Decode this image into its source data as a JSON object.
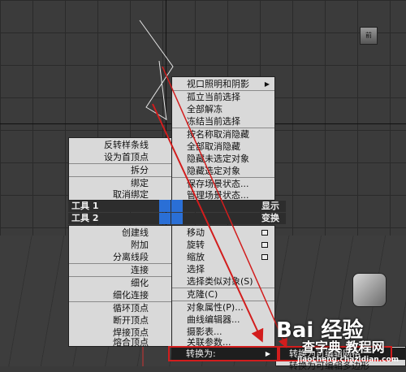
{
  "viewport": {
    "cube_label": "前"
  },
  "right_menu": {
    "items": [
      {
        "label": "视口照明和阴影",
        "submenu": true
      },
      {
        "label": "孤立当前选择"
      },
      {
        "label": "全部解冻"
      },
      {
        "label": "冻结当前选择"
      },
      {
        "label": "按名称取消隐藏"
      },
      {
        "label": "全部取消隐藏"
      },
      {
        "label": "隐藏未选定对象"
      },
      {
        "label": "隐藏选定对象"
      },
      {
        "label": "保存场景状态..."
      },
      {
        "label": "管理场景状态..."
      }
    ]
  },
  "left_menu": {
    "items": [
      {
        "label": "反转样条线"
      },
      {
        "label": "设为首顶点"
      },
      {
        "label": "拆分"
      },
      {
        "label": "绑定"
      },
      {
        "label": "取消绑定"
      }
    ]
  },
  "headers": {
    "tools1": "工具 1",
    "tools2": "工具 2",
    "display": "显示",
    "transform": "变换"
  },
  "tools_menu": {
    "items": [
      {
        "label": "创建线"
      },
      {
        "label": "附加"
      },
      {
        "label": "分离线段"
      },
      {
        "label": "连接"
      },
      {
        "label": "细化"
      },
      {
        "label": "细化连接"
      },
      {
        "label": "循环顶点"
      },
      {
        "label": "断开顶点"
      },
      {
        "label": "焊接顶点"
      },
      {
        "label": "熔合顶点"
      }
    ]
  },
  "transform_menu": {
    "items": [
      {
        "label": "移动"
      },
      {
        "label": "旋转"
      },
      {
        "label": "缩放"
      },
      {
        "label": "选择"
      },
      {
        "label": "选择类似对象(S)"
      },
      {
        "label": "克隆(C)"
      },
      {
        "label": "对象属性(P)..."
      },
      {
        "label": "曲线编辑器..."
      },
      {
        "label": "摄影表..."
      },
      {
        "label": "关联参数..."
      },
      {
        "label": "转换为:",
        "submenu": true
      }
    ]
  },
  "submenu": {
    "items": [
      {
        "label": "转换为可编辑网格"
      },
      {
        "label": "转换为可编辑多边形"
      }
    ]
  },
  "watermark": {
    "brand": "Bai  经验",
    "site_cn": "查字典 教程网",
    "site_url": "jiaocheng.chazidian.com"
  },
  "colors": {
    "annotation_red": "#d21d1d",
    "highlight_blue": "#2a6fd6"
  }
}
